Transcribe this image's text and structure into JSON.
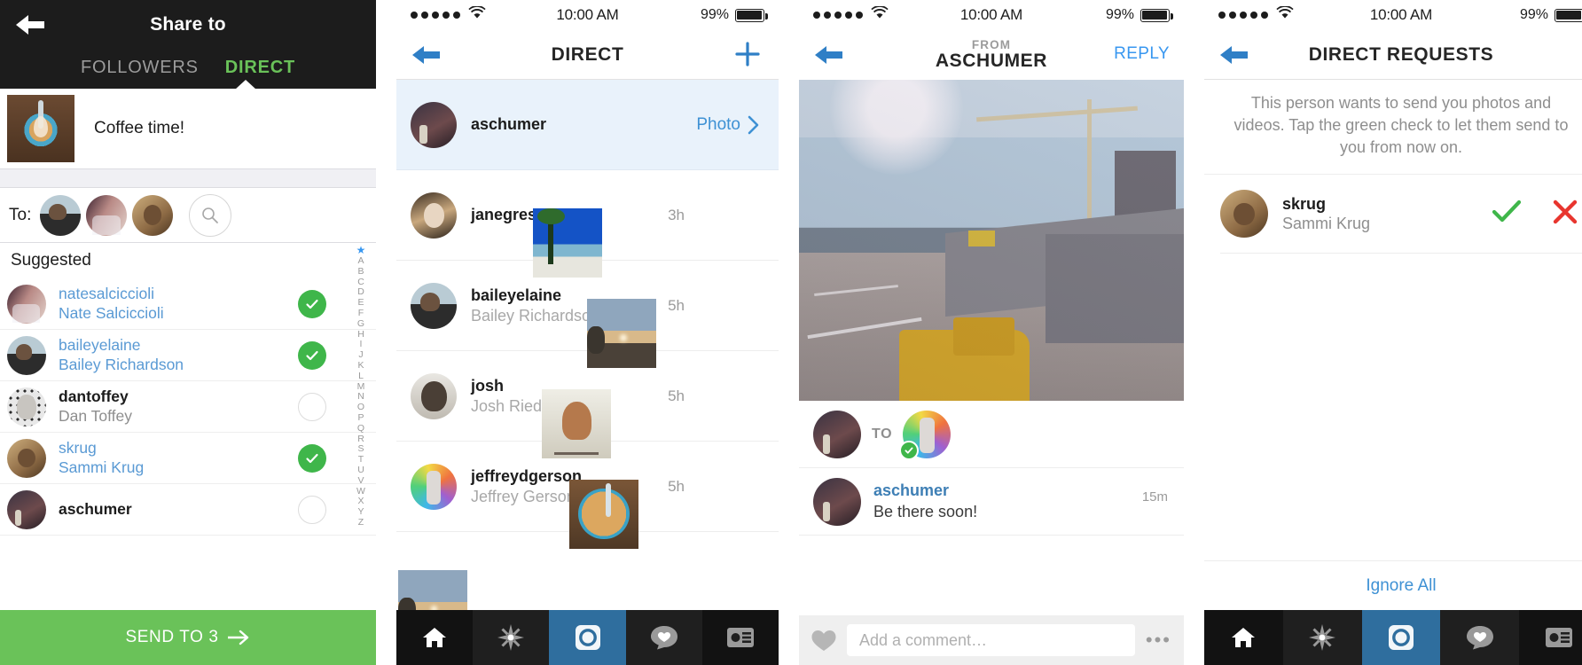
{
  "status_bar": {
    "signal_dots": 5,
    "wifi": "wifi-icon",
    "time": "10:00 AM",
    "battery_percent": "99%"
  },
  "panel_share": {
    "back_icon": "back-arrow-icon",
    "title": "Share to",
    "tabs": [
      {
        "label": "FOLLOWERS",
        "active": false
      },
      {
        "label": "DIRECT",
        "active": true
      }
    ],
    "post": {
      "caption": "Coffee time!",
      "thumbnail": "coffee-latte-photo"
    },
    "to_label": "To:",
    "to_avatars": [
      "baileyelaine-avatar",
      "natesalciccioli-avatar",
      "skrug-avatar"
    ],
    "search_icon": "search-icon",
    "suggested_header": "Suggested",
    "suggested": [
      {
        "username": "natesalciccioli",
        "fullname": "Nate Salciccioli",
        "selected": true
      },
      {
        "username": "baileyelaine",
        "fullname": "Bailey Richardson",
        "selected": true
      },
      {
        "username": "dantoffey",
        "fullname": "Dan Toffey",
        "selected": false
      },
      {
        "username": "skrug",
        "fullname": "Sammi Krug",
        "selected": true
      },
      {
        "username": "aschumer",
        "fullname": "",
        "selected": false
      }
    ],
    "alphabet_index": [
      "★",
      "A",
      "B",
      "C",
      "D",
      "E",
      "F",
      "G",
      "H",
      "I",
      "J",
      "K",
      "L",
      "M",
      "N",
      "O",
      "P",
      "Q",
      "R",
      "S",
      "T",
      "U",
      "V",
      "W",
      "X",
      "Y",
      "Z"
    ],
    "send_button": "SEND TO 3",
    "send_arrow": "right-arrow-icon",
    "accent_green": "#6ac259",
    "tab_active_color": "#6ac259"
  },
  "panel_direct": {
    "back_icon": "back-arrow-icon",
    "title": "DIRECT",
    "compose_icon": "plus-icon",
    "threads": [
      {
        "username": "aschumer",
        "fullname": "",
        "time": "",
        "link": "Photo",
        "chevron": "chevron-right-icon",
        "highlighted": true,
        "thumb": ""
      },
      {
        "username": "janegress",
        "fullname": "",
        "time": "3h",
        "thumb": "palm-trees-photo"
      },
      {
        "username": "baileyelaine",
        "fullname": "Bailey Richardson",
        "time": "5h",
        "thumb": "sunset-street-photo"
      },
      {
        "username": "josh",
        "fullname": "Josh Riedel",
        "time": "5h",
        "thumb": "dog-on-chair-photo"
      },
      {
        "username": "jeffreydgerson",
        "fullname": "Jeffrey Gerson",
        "time": "5h",
        "thumb": "coffee-latte-photo"
      }
    ]
  },
  "panel_thread": {
    "back_icon": "back-arrow-icon",
    "from_label": "FROM",
    "from_user": "ASCHUMER",
    "reply_label": "REPLY",
    "photo": "airport-tarmac-photo",
    "to_label": "TO",
    "to_sender_avatar": "aschumer-avatar",
    "to_recipient_avatar": "jeffreydgerson-avatar",
    "seen_badge": "green-check-badge",
    "comment": {
      "username": "aschumer",
      "text": "Be there soon!",
      "time": "15m"
    },
    "composer": {
      "heart_icon": "heart-icon",
      "placeholder": "Add a comment…",
      "more_icon": "more-dots-icon"
    }
  },
  "panel_requests": {
    "back_icon": "back-arrow-icon",
    "title": "DIRECT REQUESTS",
    "info_text": "This person wants to send you photos and videos. Tap the green check to let them send to you from now on.",
    "requests": [
      {
        "username": "skrug",
        "fullname": "Sammi Krug",
        "accept_icon": "green-check-icon",
        "decline_icon": "red-x-icon"
      }
    ],
    "ignore_all": "Ignore All",
    "accept_color": "#3fb64a",
    "decline_color": "#e8352e"
  },
  "tab_bar": {
    "items": [
      {
        "icon": "home-icon",
        "active": false
      },
      {
        "icon": "explore-star-icon",
        "active": false
      },
      {
        "icon": "camera-icon",
        "active": true
      },
      {
        "icon": "activity-heart-icon",
        "active": false
      },
      {
        "icon": "profile-card-icon",
        "active": false
      }
    ],
    "active_color": "#2f6e9e"
  }
}
